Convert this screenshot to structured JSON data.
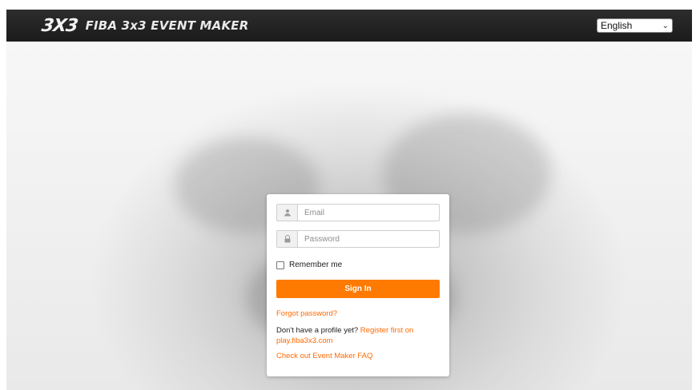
{
  "topbar": {
    "logo_mark": "3X3",
    "logo_text": "FIBA 3x3 EVENT MAKER",
    "language": {
      "selected": "English",
      "icon": "chevron-down-icon"
    }
  },
  "login": {
    "email_placeholder": "Email",
    "password_placeholder": "Password",
    "remember_label": "Remember me",
    "signin_label": "Sign In",
    "forgot_label": "Forgot password?",
    "no_profile_text": "Don't have a profile yet?",
    "register_link": "Register first on play.fiba3x3.com",
    "faq_link": "Check out Event Maker FAQ"
  },
  "colors": {
    "accent": "#ff7a00",
    "topbar": "#1f1f1f",
    "link": "#ff6a00"
  }
}
